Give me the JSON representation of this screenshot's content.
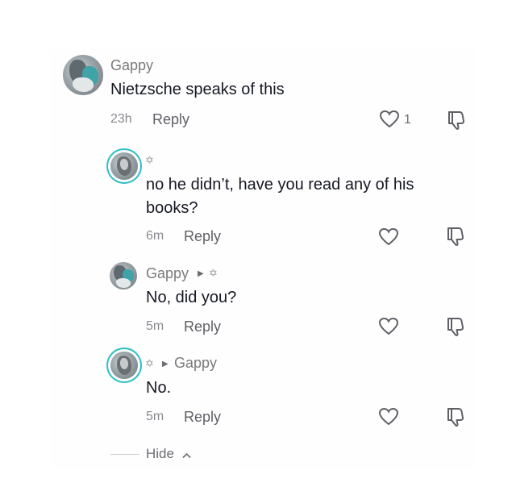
{
  "colors": {
    "text_primary": "#161823",
    "text_secondary": "#8a8b91",
    "username": "#7a7a7a",
    "ring": "#2dbfc4"
  },
  "comments": [
    {
      "username": "Gappy",
      "text": "Nietzsche speaks of this",
      "time": "23h",
      "reply_label": "Reply",
      "like_count": "1",
      "icons": [
        "heart-outline-icon",
        "thumb-down-icon"
      ]
    }
  ],
  "replies": [
    {
      "username": "",
      "badge": "✡",
      "text": "no he didn’t, have you read any of his books?",
      "time": "6m",
      "reply_label": "Reply"
    },
    {
      "username": "Gappy",
      "badge": "✡",
      "reply_to_arrow": "▶",
      "text": "No, did you?",
      "time": "5m",
      "reply_label": "Reply"
    },
    {
      "username": "Gappy",
      "badge": "✡",
      "reply_to_arrow": "▶",
      "text": "No.",
      "time": "5m",
      "reply_label": "Reply"
    }
  ],
  "hide": {
    "label": "Hide",
    "chevron": "^"
  }
}
